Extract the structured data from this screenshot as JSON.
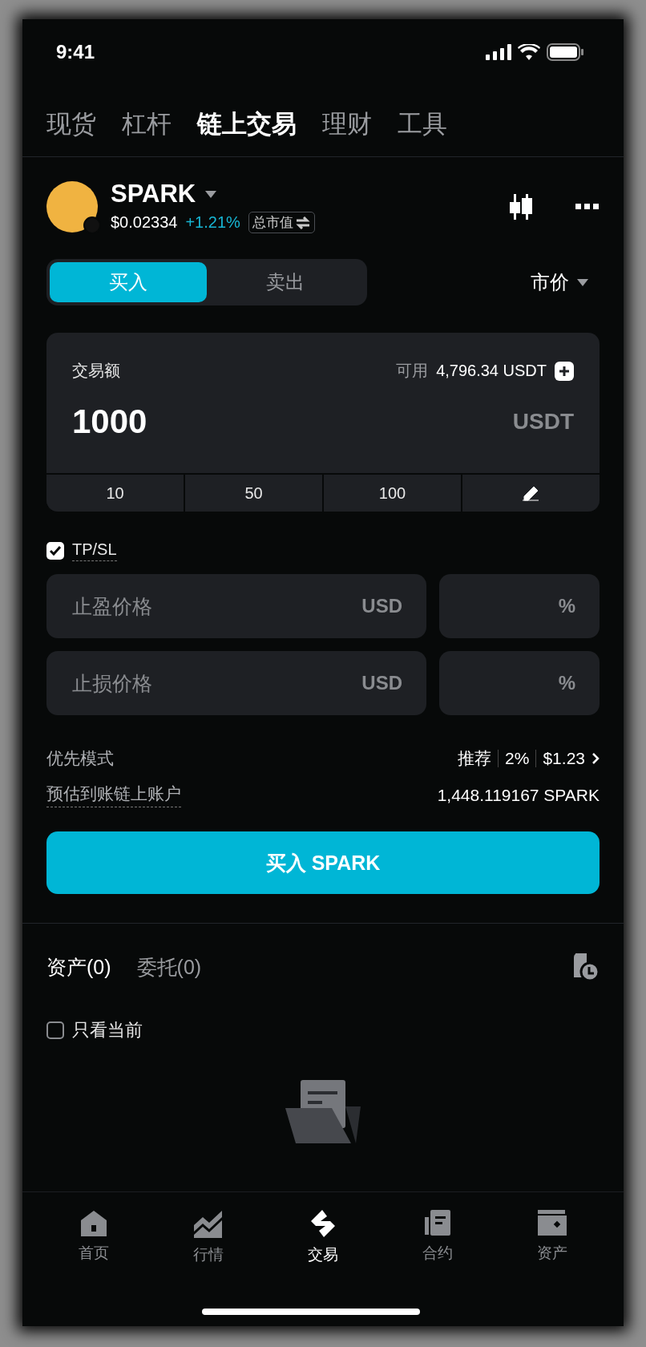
{
  "status_bar": {
    "time": "9:41"
  },
  "top_tabs": [
    {
      "label": "现货",
      "selected": false
    },
    {
      "label": "杠杆",
      "selected": false
    },
    {
      "label": "链上交易",
      "selected": true
    },
    {
      "label": "理财",
      "selected": false
    },
    {
      "label": "工具",
      "selected": false
    }
  ],
  "token": {
    "symbol": "SPARK",
    "price": "$0.02334",
    "change": "+1.21%",
    "toggle_label": "总市值"
  },
  "side_toggle": [
    {
      "label": "买入",
      "selected": true
    },
    {
      "label": "卖出",
      "selected": false
    }
  ],
  "order_type": "市价",
  "amount_card": {
    "label": "交易额",
    "available_label": "可用",
    "available_value": "4,796.34 USDT",
    "value": "1000",
    "unit": "USDT",
    "presets": [
      "10",
      "50",
      "100"
    ]
  },
  "tpsl": {
    "label": "TP/SL",
    "checked": true,
    "fields": [
      {
        "placeholder": "止盈价格",
        "unit": "USD",
        "percent_unit": "%"
      },
      {
        "placeholder": "止损价格",
        "unit": "USD",
        "percent_unit": "%"
      }
    ]
  },
  "priority": {
    "label": "优先模式",
    "mode": "推荐",
    "percent": "2%",
    "fee": "$1.23"
  },
  "estimate": {
    "label": "预估到账链上账户",
    "value": "1,448.119167 SPARK"
  },
  "buy_button": "买入 SPARK",
  "bottom_tabs": [
    {
      "label": "资产(0)",
      "selected": true
    },
    {
      "label": "委托(0)",
      "selected": false
    }
  ],
  "only_current": {
    "label": "只看当前",
    "checked": false
  },
  "nav": [
    {
      "label": "首页",
      "kind": "home",
      "selected": false
    },
    {
      "label": "行情",
      "kind": "market",
      "selected": false
    },
    {
      "label": "交易",
      "kind": "trade",
      "selected": true
    },
    {
      "label": "合约",
      "kind": "futures",
      "selected": false
    },
    {
      "label": "资产",
      "kind": "assets",
      "selected": false
    }
  ]
}
